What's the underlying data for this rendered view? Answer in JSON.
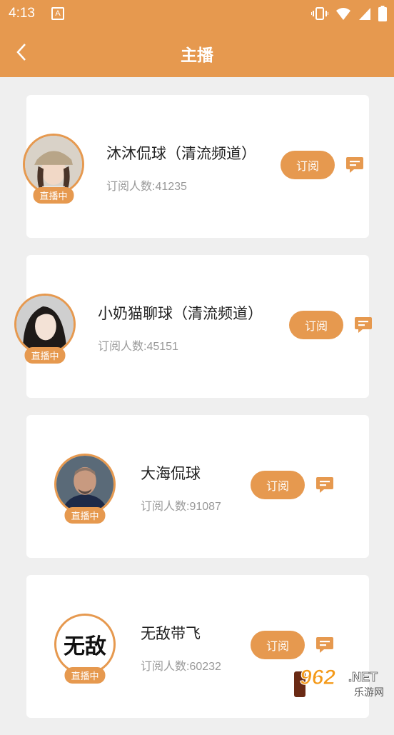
{
  "status_bar": {
    "time": "4:13",
    "a_icon": "A"
  },
  "header": {
    "title": "主播",
    "back_icon": "chevron-left-icon"
  },
  "anchors": [
    {
      "name": "沐沐侃球（清流频道）",
      "subscribers": "订阅人数:41235",
      "live": "直播中",
      "subscribe_label": "订阅"
    },
    {
      "name": "小奶猫聊球（清流频道）",
      "subscribers": "订阅人数:45151",
      "live": "直播中",
      "subscribe_label": "订阅"
    },
    {
      "name": "大海侃球",
      "subscribers": "订阅人数:91087",
      "live": "直播中",
      "subscribe_label": "订阅"
    },
    {
      "name": "无敌带飞",
      "subscribers": "订阅人数:60232",
      "live": "直播中",
      "subscribe_label": "订阅"
    }
  ],
  "avatar4_text": "无敌",
  "watermark": {
    "number": "962",
    "suffix": ".NET",
    "sub": "乐游网"
  },
  "colors": {
    "accent": "#e6994f",
    "background": "#efefef"
  }
}
